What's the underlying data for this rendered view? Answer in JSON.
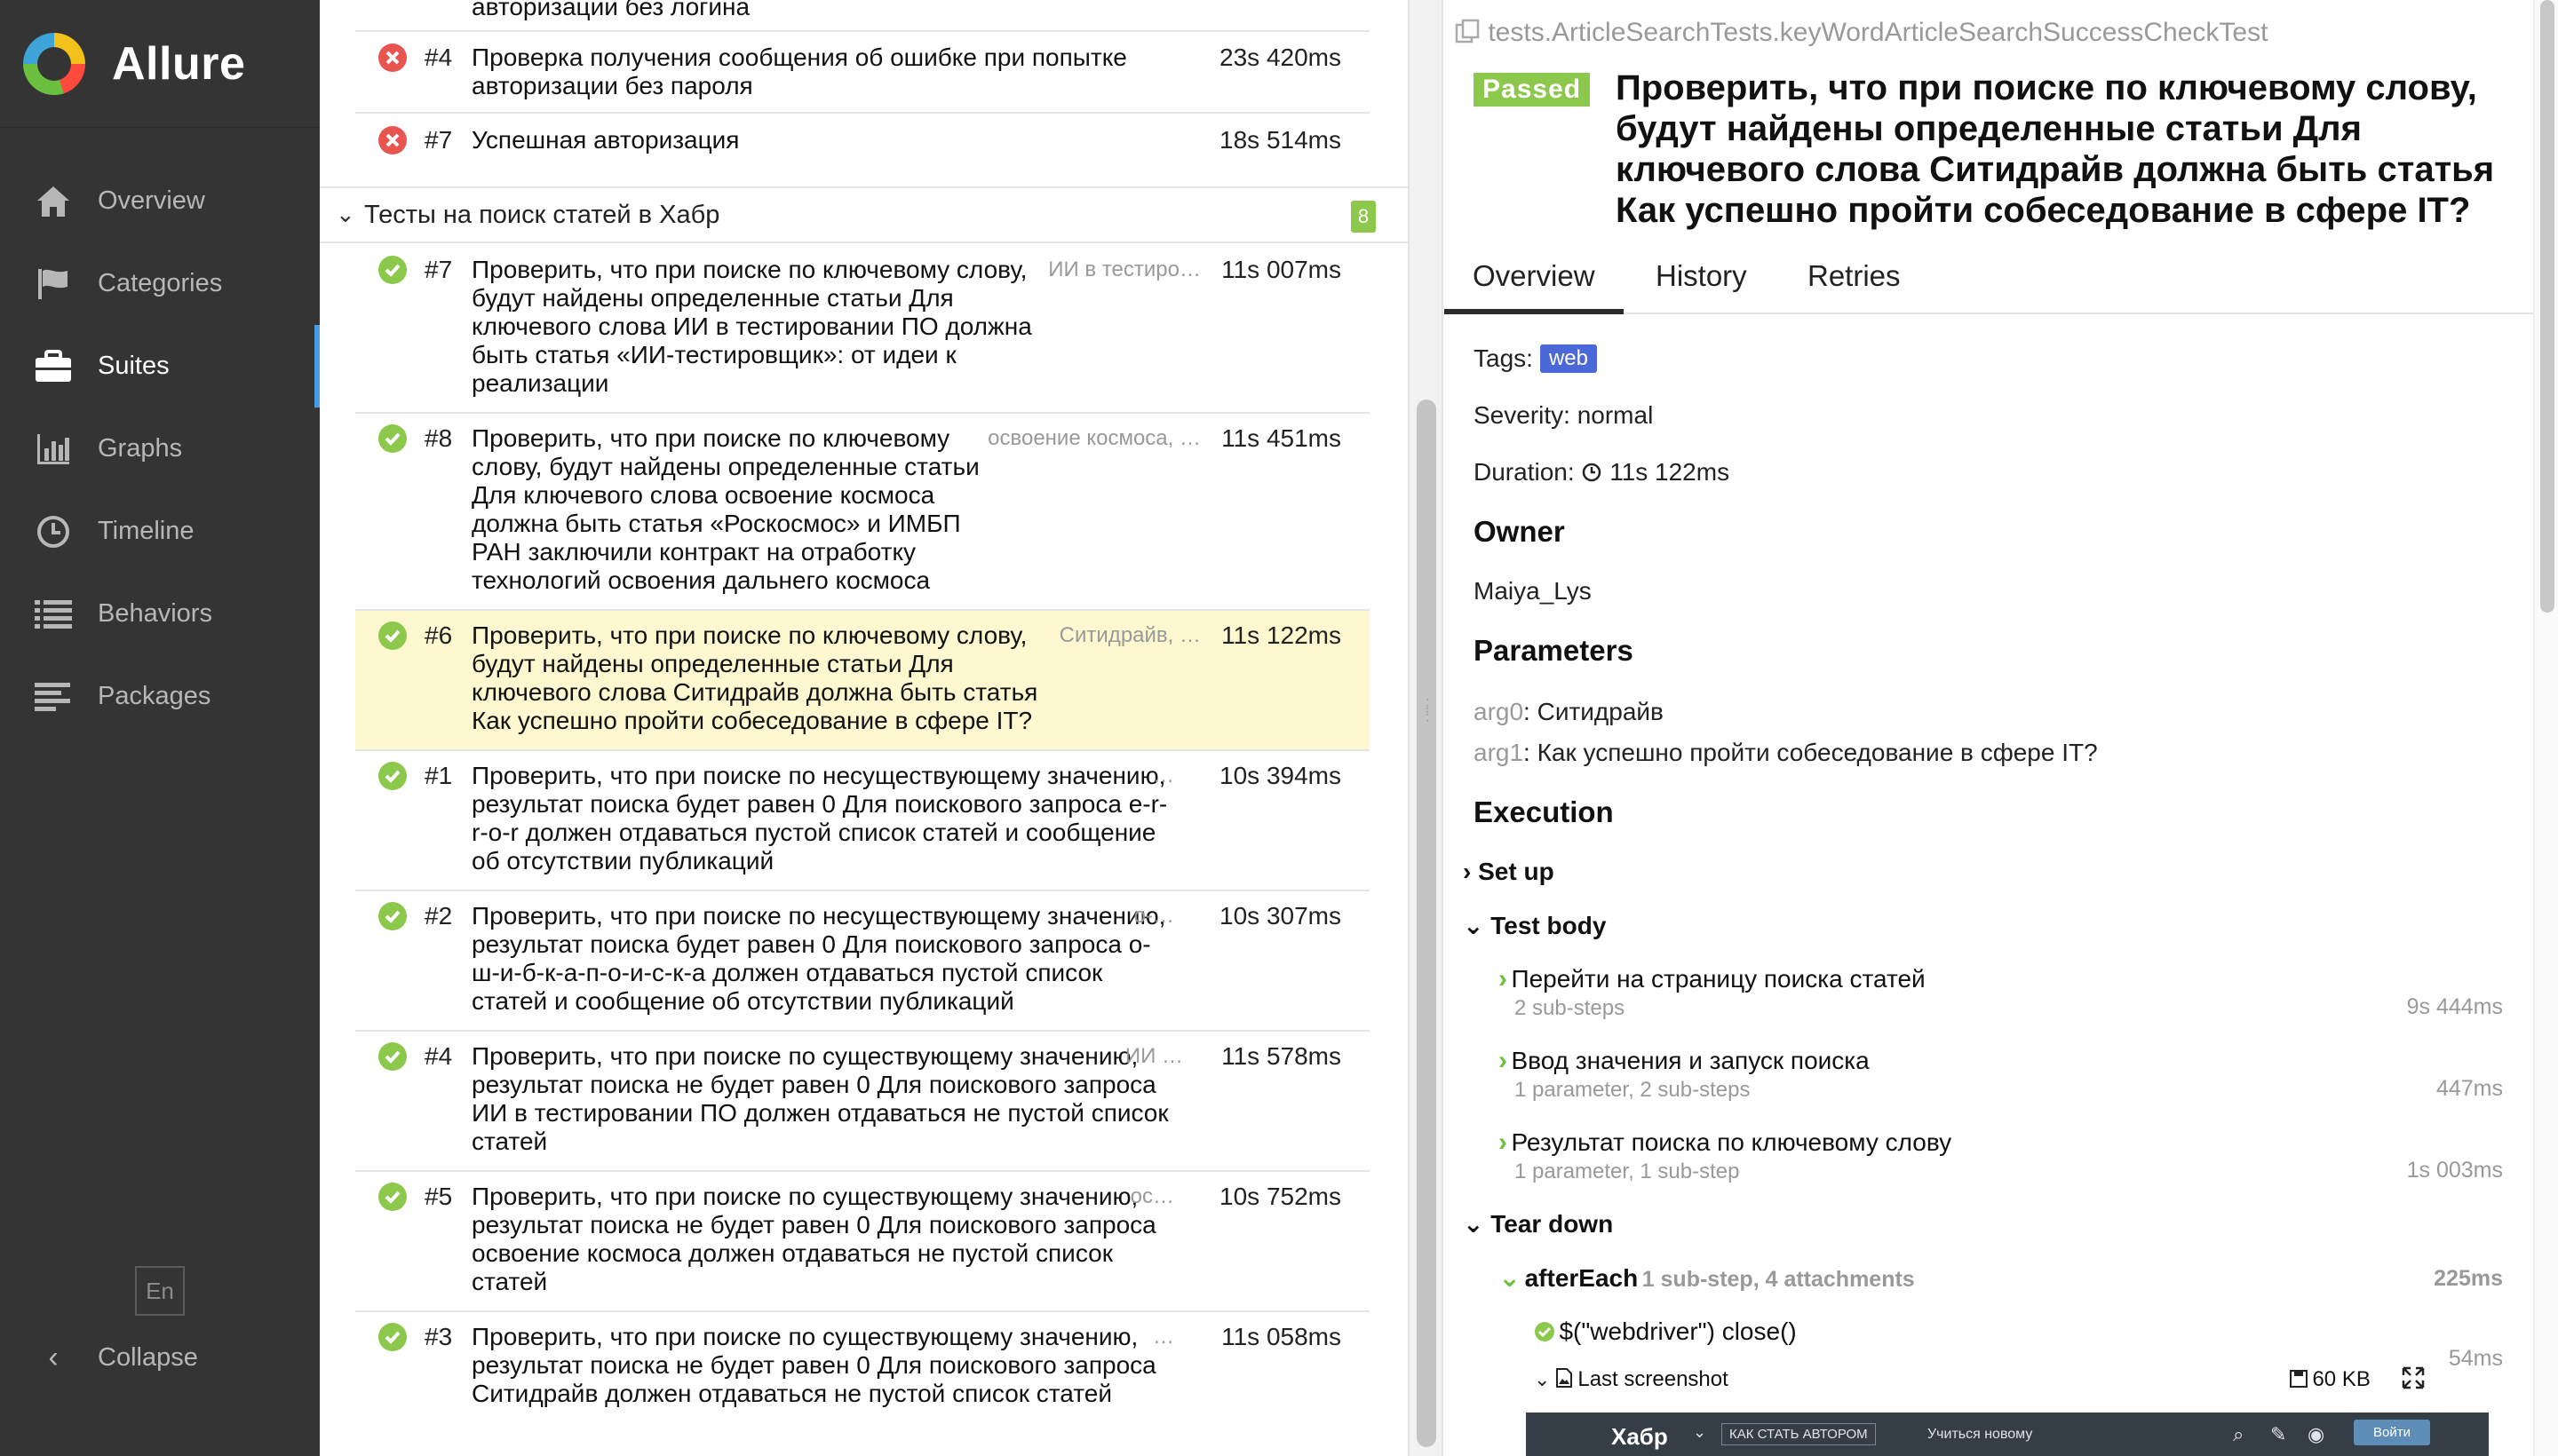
{
  "app": {
    "name": "Allure"
  },
  "sidebar": {
    "items": [
      {
        "label": "Overview",
        "icon": "home-icon"
      },
      {
        "label": "Categories",
        "icon": "flag-icon"
      },
      {
        "label": "Suites",
        "icon": "briefcase-icon",
        "active": true
      },
      {
        "label": "Graphs",
        "icon": "bar-chart-icon"
      },
      {
        "label": "Timeline",
        "icon": "clock-icon"
      },
      {
        "label": "Behaviors",
        "icon": "list-icon"
      },
      {
        "label": "Packages",
        "icon": "align-left-icon"
      }
    ],
    "lang": "En",
    "collapse_label": "Collapse"
  },
  "tree": {
    "top_partial": "авторизации без логина",
    "failed_rows": [
      {
        "num": "#4",
        "title": "Проверка получения сообщения об ошибке при попытке авторизации без пароля",
        "duration": "23s 420ms"
      },
      {
        "num": "#7",
        "title": "Успешная авторизация",
        "duration": "18s 514ms"
      }
    ],
    "group": {
      "title": "Тесты на поиск статей в Хабр",
      "count": "8"
    },
    "rows": [
      {
        "num": "#7",
        "title": "Проверить, что при поиске по ключевому слову, будут найдены определенные статьи Для ключевого слова ИИ в тестировании ПО должна быть статья «ИИ-тестировщик»: от идеи к реализации",
        "param": "ИИ в тестиро…",
        "duration": "11s 007ms"
      },
      {
        "num": "#8",
        "title": "Проверить, что при поиске по ключевому слову, будут найдены определенные статьи Для ключевого слова освоение космоса должна быть статья «Роскосмос» и ИМБП РАН заключили контракт на отработку технологий освоения дальнего космоса",
        "param": "освоение космоса, …",
        "duration": "11s 451ms"
      },
      {
        "num": "#6",
        "title": "Проверить, что при поиске по ключевому слову, будут найдены определенные статьи Для ключевого слова Ситидрайв должна быть статья Как успешно пройти собеседование в сфере IT?",
        "param": "Ситидрайв, …",
        "duration": "11s 122ms",
        "selected": true
      },
      {
        "num": "#1",
        "title": "Проверить, что при поиске по несуществующему значению, результат поиска будет равен 0 Для поискового запроса e-r-r-o-r должен отдаваться пустой список статей и сообщение об отсутствии публикаций",
        "param": "…",
        "duration": "10s 394ms"
      },
      {
        "num": "#2",
        "title": "Проверить, что при поиске по несуществующему значению, результат поиска будет равен 0 Для поискового запроса о-ш-и-б-к-а-п-о-и-с-к-а должен отдаваться пустой список статей и сообщение об отсутствии публикаций",
        "param": "о-…",
        "duration": "10s 307ms"
      },
      {
        "num": "#4",
        "title": "Проверить, что при поиске по существующему значению, результат поиска не будет равен 0 Для поискового запроса ИИ в тестировании ПО должен отдаваться не пустой список статей",
        "param": "ИИ …",
        "duration": "11s 578ms"
      },
      {
        "num": "#5",
        "title": "Проверить, что при поиске по существующему значению, результат поиска не будет равен 0 Для поискового запроса освоение космоса должен отдаваться не пустой список статей",
        "param": "ос…",
        "duration": "10s 752ms"
      },
      {
        "num": "#3",
        "title": "Проверить, что при поиске по существующему значению, результат поиска не будет равен 0 Для поискового запроса Ситидрайв должен отдаваться не пустой список статей",
        "param": "…",
        "duration": "11s 058ms"
      }
    ]
  },
  "detail": {
    "full_name": "tests.ArticleSearchTests.keyWordArticleSearchSuccessCheckTest",
    "status": "Passed",
    "title": "Проверить, что при поиске по ключевому слову, будут найдены определенные статьи Для ключевого слова Ситидрайв должна быть статья Как успешно пройти собеседование в сфере IT?",
    "tabs": [
      "Overview",
      "History",
      "Retries"
    ],
    "tags_label": "Tags:",
    "tag": "web",
    "severity": "Severity: normal",
    "duration_label": "Duration:",
    "duration": "11s 122ms",
    "owner_heading": "Owner",
    "owner": "Maiya_Lys",
    "parameters_heading": "Parameters",
    "params": [
      {
        "name": "arg0",
        "value": "Ситидрайв"
      },
      {
        "name": "arg1",
        "value": "Как успешно пройти собеседование в сфере IT?"
      }
    ],
    "execution_heading": "Execution",
    "setup": "Set up",
    "test_body": "Test body",
    "steps": [
      {
        "title": "Перейти на страницу поиска статей",
        "sub": "2 sub-steps",
        "duration": "9s 444ms"
      },
      {
        "title": "Ввод значения и запуск поиска",
        "sub": "1 parameter, 2 sub-steps",
        "duration": "447ms"
      },
      {
        "title": "Результат поиска по ключевому слову",
        "sub": "1 parameter, 1 sub-step",
        "duration": "1s 003ms"
      }
    ],
    "teardown": "Tear down",
    "after_each": {
      "title": "afterEach",
      "meta": "1 sub-step, 4 attachments",
      "duration": "225ms"
    },
    "close_step": {
      "title": "$(\"webdriver\") close()",
      "duration": "54ms"
    },
    "attachment": {
      "title": "Last screenshot",
      "size": "60 KB"
    },
    "screenshot": {
      "site": "Хабр",
      "author_btn": "КАК СТАТЬ АВТОРОМ",
      "learn": "Учиться новому",
      "login": "Войти"
    }
  },
  "colors": {
    "passed": "#8cc84b",
    "failed": "#e8554e",
    "sidebar": "#343434",
    "selected": "#fdf8cf",
    "tag": "#4a68d8"
  }
}
